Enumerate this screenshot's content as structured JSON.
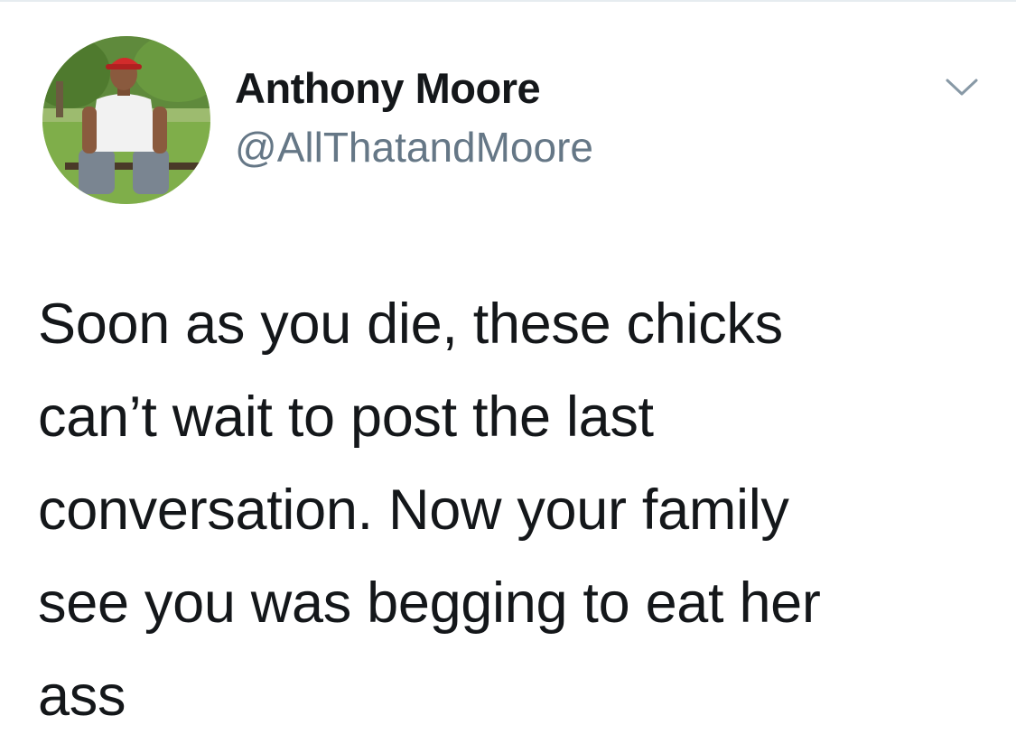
{
  "author": {
    "display_name": "Anthony Moore",
    "handle": "@AllThatandMoore",
    "avatar_icon": "user-avatar-photo"
  },
  "header": {
    "menu_icon": "chevron-down-icon"
  },
  "tweet": {
    "lines": [
      "Soon as you die, these chicks",
      "can’t wait to post the last",
      "conversation. Now your family",
      "see you was begging to eat her",
      "ass"
    ]
  },
  "colors": {
    "text": "#14171a",
    "secondary": "#657786",
    "divider": "#e6ecf0"
  }
}
